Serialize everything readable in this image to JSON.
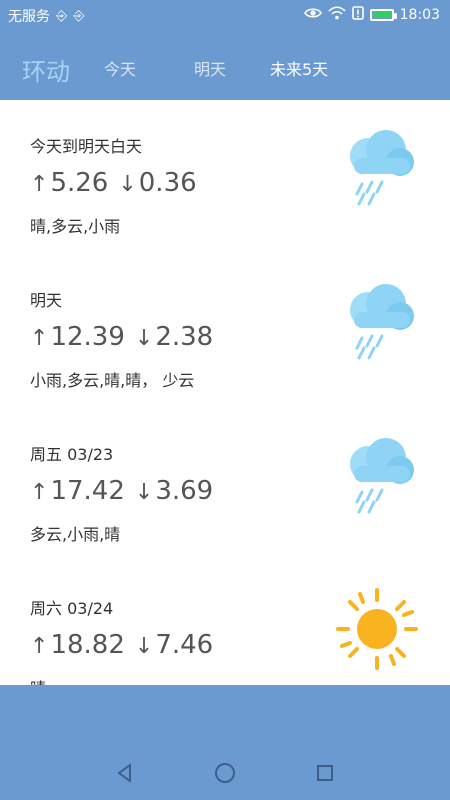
{
  "status_bar": {
    "carrier": "无服务",
    "time": "18:03"
  },
  "header": {
    "brand": "环动",
    "tabs": [
      {
        "label": "今天"
      },
      {
        "label": "明天"
      },
      {
        "label": "未来5天"
      }
    ],
    "active_tab": "未来5天"
  },
  "cards": [
    {
      "title": "今天到明天白天",
      "high": "5.26",
      "low": "0.36",
      "desc": "晴,多云,小雨",
      "icon": "rain-cloud-icon"
    },
    {
      "title": "明天",
      "high": "12.39",
      "low": "2.38",
      "desc": "小雨,多云,晴,晴， 少云",
      "icon": "rain-cloud-icon"
    },
    {
      "title": "周五 03/23",
      "high": "17.42",
      "low": "3.69",
      "desc": "多云,小雨,晴",
      "icon": "rain-cloud-icon"
    },
    {
      "title": "周六 03/24",
      "high": "18.82",
      "low": "7.46",
      "desc": "晴",
      "icon": "sun-icon"
    }
  ],
  "colors": {
    "primary": "#6b9ad0",
    "brand": "#a7d3f7",
    "sun": "#f9b320",
    "cloud": "#8fd3f5"
  },
  "symbols": {
    "up_arrow": "↑",
    "down_arrow": "↓"
  }
}
